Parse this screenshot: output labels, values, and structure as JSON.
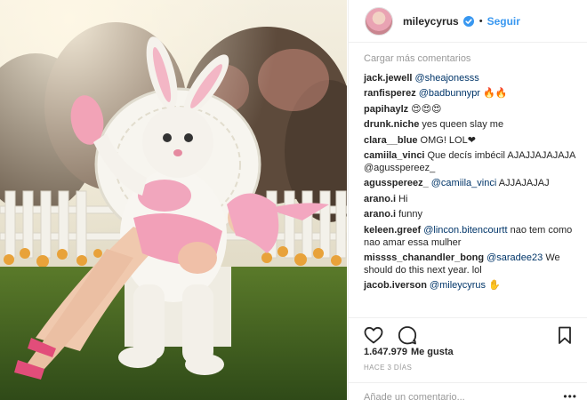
{
  "post": {
    "username": "mileycyrus",
    "follow_label": "Seguir",
    "load_more": "Cargar más comentarios",
    "likes_count": "1.647.979",
    "likes_label": "Me gusta",
    "time": "HACE 3 DÍAS",
    "add_comment_placeholder": "Añade un comentario...",
    "more_options": "•••"
  },
  "comments": [
    {
      "user": "jack.jewell",
      "mention": "@sheajonesss",
      "text": ""
    },
    {
      "user": "ranfisperez",
      "mention": "@badbunnypr",
      "text": "🔥🔥"
    },
    {
      "user": "papihaylz",
      "mention": "",
      "text": "😍😍😍"
    },
    {
      "user": "drunk.niche",
      "mention": "",
      "text": "yes queen slay me"
    },
    {
      "user": "clara__blue",
      "mention": "",
      "text": "OMG! LOL❤"
    },
    {
      "user": "camiila_vinci",
      "mention": "",
      "text": "Que decís imbécil AJAJJAJAJAJA @agusspereez_"
    },
    {
      "user": "agusspereez_",
      "mention": "@camiila_vinci",
      "text": "AJJAJAJAJ"
    },
    {
      "user": "arano.i",
      "mention": "",
      "text": "Hi"
    },
    {
      "user": "arano.i",
      "mention": "",
      "text": "funny"
    },
    {
      "user": "keleen.greef",
      "mention": "@lincon.bitencourtt",
      "text": "nao tem como nao amar essa mulher"
    },
    {
      "user": "missss_chanandler_bong",
      "mention": "@saradee23",
      "text": "We should do this next year. lol"
    },
    {
      "user": "jacob.iverson",
      "mention": "@mileycyrus",
      "text": "✋"
    }
  ],
  "colors": {
    "link": "#3897f0",
    "mention": "#003569",
    "muted": "#999999",
    "verified": "#3897f0"
  },
  "icons": [
    "verified-badge-icon",
    "heart-icon",
    "comment-icon",
    "bookmark-icon",
    "more-options-icon"
  ]
}
